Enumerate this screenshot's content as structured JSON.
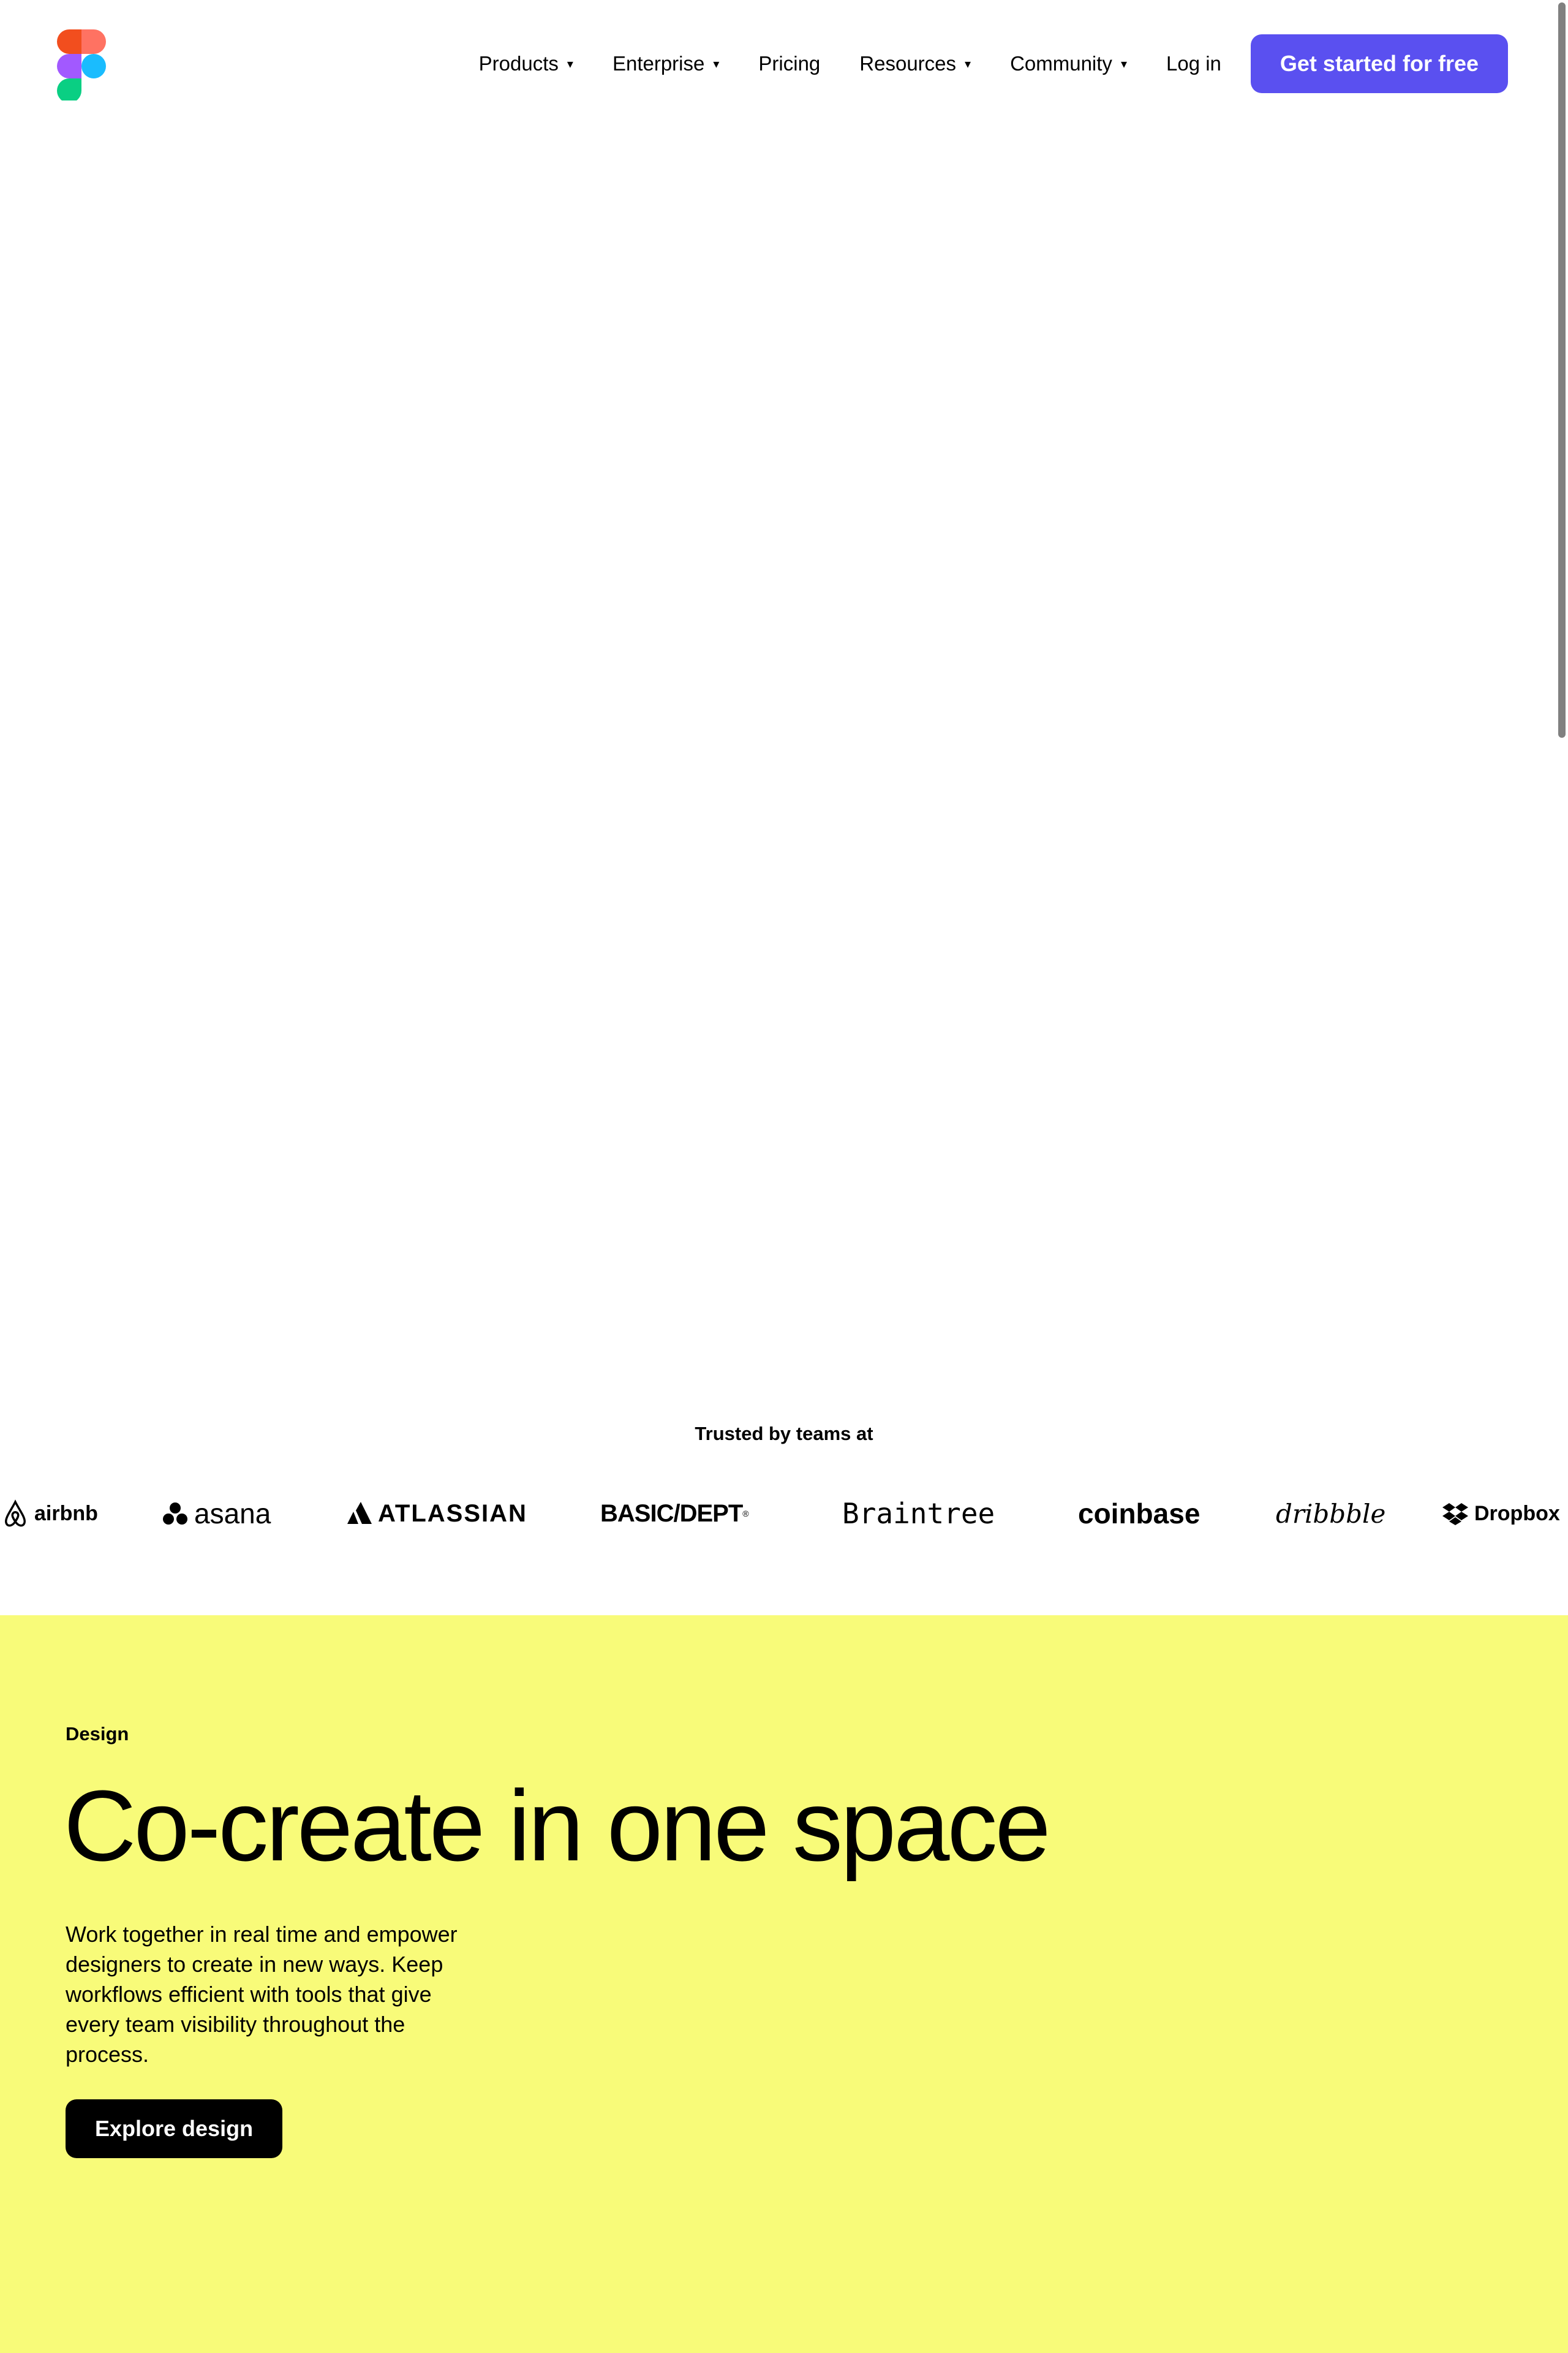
{
  "header": {
    "logo_icon": "figma-logo-icon",
    "nav": [
      {
        "label": "Products",
        "has_dropdown": true
      },
      {
        "label": "Enterprise",
        "has_dropdown": true
      },
      {
        "label": "Pricing",
        "has_dropdown": false
      },
      {
        "label": "Resources",
        "has_dropdown": true
      },
      {
        "label": "Community",
        "has_dropdown": true
      }
    ],
    "caret": "▾",
    "login_label": "Log in",
    "cta_label": "Get started for free",
    "cta_color": "#5a50f0"
  },
  "trusted": {
    "heading": "Trusted by teams at",
    "logos": {
      "airbnb": "airbnb",
      "asana": "asana",
      "atlassian": "ATLASSIAN",
      "basic": "BASIC/DEPT",
      "braintree": "Braintree",
      "coinbase": "coinbase",
      "dribbble": "dribbble",
      "dropbox": "Dropbox"
    }
  },
  "design_section": {
    "background": "#f8fb79",
    "label": "Design",
    "title": "Co-create in one space",
    "description": "Work together in real time and empower designers to create in new ways. Keep workflows efficient with tools that give every team visibility throughout the process.",
    "button_label": "Explore design"
  }
}
